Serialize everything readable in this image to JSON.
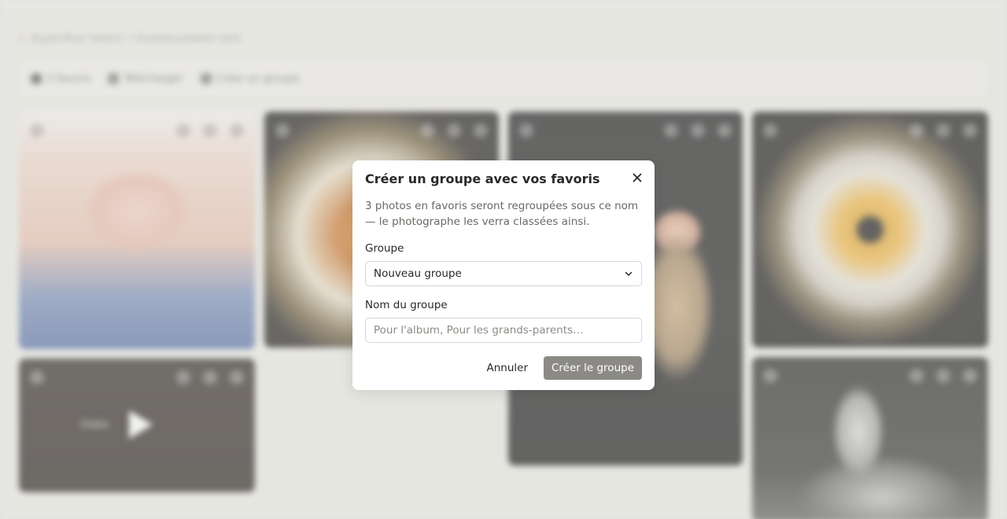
{
  "background": {
    "breadcrumb": "Voyez-Pour tebom • Overlecunewrer tent",
    "toolbar": {
      "favorites_label": "3 favoris",
      "download_label": "Télécharger",
      "create_group_label": "Créer un groupe"
    },
    "video_tile_label": "Vidéo"
  },
  "modal": {
    "title": "Créer un groupe avec vos favoris",
    "description": "3 photos en favoris seront regroupées sous ce nom — le photographe les verra classées ainsi.",
    "group_label": "Groupe",
    "group_selected": "Nouveau groupe",
    "name_label": "Nom du groupe",
    "name_placeholder": "Pour l'album, Pour les grands-parents…",
    "name_value": "",
    "cancel_label": "Annuler",
    "create_label": "Créer le groupe"
  },
  "icons": {
    "close": "close-icon",
    "chevron": "chevron-down-icon",
    "play": "play-icon"
  },
  "colors": {
    "create_button_bg": "#8c8a86",
    "overlay": "#e1dfdb"
  }
}
